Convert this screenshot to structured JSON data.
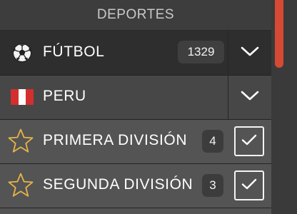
{
  "header": {
    "title": "DEPORTES"
  },
  "sport": {
    "label": "FÚTBOL",
    "count": "1329",
    "icon": "soccer-ball-icon"
  },
  "country": {
    "label": "PERU",
    "icon": "peru-flag-icon"
  },
  "leagues": [
    {
      "label": "PRIMERA DIVISIÓN",
      "count": "4",
      "selected": true,
      "icon": "star-outline-icon"
    },
    {
      "label": "SEGUNDA DIVISIÓN",
      "count": "3",
      "selected": true,
      "icon": "star-outline-icon"
    }
  ],
  "colors": {
    "accent": "#d64a33",
    "star": "#e8b447",
    "flag_red": "#d32f2f"
  }
}
